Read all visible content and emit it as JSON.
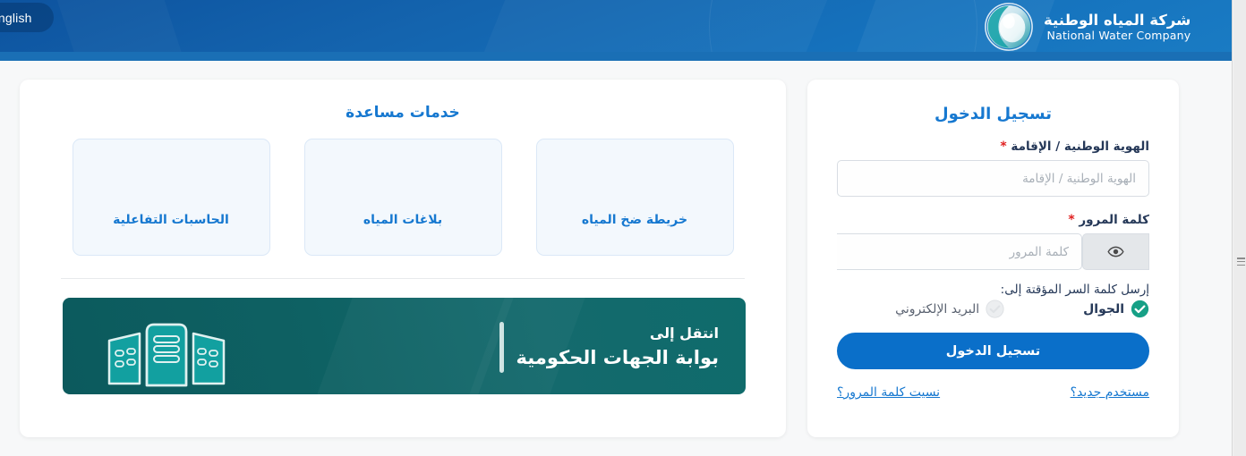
{
  "header": {
    "language_button": "English",
    "brand_ar": "شركة المياه الوطنية",
    "brand_en": "National Water Company",
    "logo_icon": "water-drop-circle-logo",
    "colors": {
      "gradient_start": "#0d539f",
      "gradient_end": "#1a7cc4",
      "bottom_strip": "#1a6fb5"
    }
  },
  "services": {
    "title": "خدمات مساعدة",
    "tiles": [
      {
        "label": "الحاسبات التفاعلية"
      },
      {
        "label": "بلاغات المياه"
      },
      {
        "label": "خريطة ضخ المياه"
      }
    ]
  },
  "gov_banner": {
    "line1": "انتقل إلى",
    "line2": "بوابة الجهات الحكومية",
    "icon": "government-buildings-icon",
    "background_color": "#0f6b6b",
    "icon_color": "#11a0a0"
  },
  "login": {
    "title": "تسجيل الدخول",
    "id_field": {
      "label": "الهوية الوطنية / الإقامة",
      "required_marker": "*",
      "placeholder": "الهوية الوطنية / الإقامة",
      "value": ""
    },
    "password_field": {
      "label": "كلمة المرور",
      "required_marker": "*",
      "placeholder": "كلمة المرور",
      "value": "",
      "toggle_icon": "eye-icon"
    },
    "otp": {
      "label": "إرسل كلمة السر المؤقتة إلى:",
      "options": [
        {
          "label": "الجوال",
          "selected": true,
          "icon": "check-circle-icon"
        },
        {
          "label": "البريد الإلكتروني",
          "selected": false,
          "icon": "empty-circle-icon"
        }
      ],
      "selected_color": "#16a086"
    },
    "submit_label": "تسجيل الدخول",
    "submit_color": "#0a6fc9",
    "links": [
      {
        "label": "مستخدم جديد؟"
      },
      {
        "label": "نسيت كلمة المرور؟"
      }
    ],
    "link_color": "#1678d0"
  },
  "scrollbar": {
    "grip_icon": "scroll-grip-icon"
  }
}
